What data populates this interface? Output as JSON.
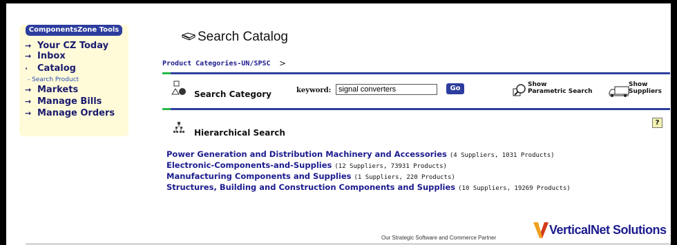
{
  "sidebar": {
    "header": "ComponentsZone Tools",
    "items": [
      {
        "label": "Your CZ Today",
        "arrow": "→"
      },
      {
        "label": "Inbox",
        "arrow": "→"
      },
      {
        "label": "Catalog",
        "arrow": "·"
      },
      {
        "label": "Markets",
        "arrow": "→"
      },
      {
        "label": "Manage Bills",
        "arrow": "→"
      },
      {
        "label": "Manage Orders",
        "arrow": "→"
      }
    ],
    "sub_item": "- Search Product"
  },
  "page": {
    "title": "Search Catalog",
    "title_icon": "book-icon"
  },
  "breadcrumb": {
    "label": "Product Categories-UN/SPSC",
    "separator": ">"
  },
  "search": {
    "label": "Search Category",
    "keyword_label": "keyword:",
    "keyword_value": "signal converters",
    "go_label": "Go",
    "parametric_line1": "Show",
    "parametric_line2": "Parametric Search",
    "suppliers_line1": "Show",
    "suppliers_line2": "Suppliers"
  },
  "hierarchical": {
    "label": "Hierarchical Search",
    "help": "?",
    "categories": [
      {
        "name": "Power Generation and Distribution Machinery and Accessories",
        "meta": "(4 Suppliers,  1031 Products)"
      },
      {
        "name": "Electronic-Components-and-Supplies",
        "meta": "(12 Suppliers,  73931 Products)"
      },
      {
        "name": "Manufacturing Components and Supplies",
        "meta": "(1 Suppliers,  220 Products)"
      },
      {
        "name": "Structures, Building and Construction Components and Supplies",
        "meta": "(10 Suppliers,  19269 Products)"
      }
    ]
  },
  "footer": {
    "partner_text": "Our Strategic Software and Commerce Partner",
    "logo_text": "VerticalNet Solutions"
  },
  "colors": {
    "accent": "#2d3d9e",
    "link": "#1b1b8e",
    "sidebar_bg": "#fffbd9",
    "green": "#27b84a",
    "logo_v": "#f0a020"
  }
}
